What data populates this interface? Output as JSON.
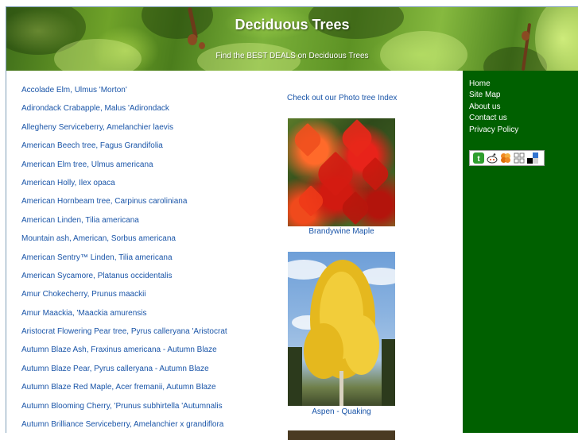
{
  "header": {
    "title": "Deciduous Trees",
    "subtitle": "Find the BEST DEALS on Deciduous Trees"
  },
  "trees": [
    "Accolade Elm, Ulmus 'Morton'",
    "Adirondack Crabapple, Malus 'Adirondack",
    "Allegheny Serviceberry, Amelanchier laevis",
    "American Beech tree, Fagus Grandifolia",
    "American Elm tree, Ulmus americana",
    "American Holly, Ilex opaca",
    "American Hornbeam tree, Carpinus caroliniana",
    "American Linden, Tilia americana",
    "Mountain ash, American, Sorbus americana",
    "American Sentry™ Linden, Tilia americana",
    "American Sycamore, Platanus occidentalis",
    "Amur Chokecherry, Prunus maackii",
    "Amur Maackia, 'Maackia amurensis",
    "Aristocrat Flowering Pear tree, Pyrus calleryana 'Aristocrat",
    "Autumn Blaze Ash, Fraxinus americana - Autumn Blaze",
    "Autumn Blaze Pear, Pyrus calleryana - Autumn Blaze",
    "Autumn Blaze Red Maple, Acer fremanii, Autumn Blaze",
    "Autumn Blooming Cherry, 'Prunus subhirtella 'Autumnalis",
    "Autumn Brilliance Serviceberry, Amelanchier x grandiflora"
  ],
  "photo_index": {
    "link_text": "Check out our Photo tree Index",
    "photos": [
      {
        "caption": "Brandywine Maple"
      },
      {
        "caption": "Aspen - Quaking"
      }
    ]
  },
  "sidebar": {
    "nav": [
      "Home",
      "Site Map",
      "About us",
      "Contact us",
      "Privacy Policy"
    ],
    "share_icons": [
      "technorati-icon",
      "reddit-icon",
      "stumbleupon-icon",
      "digg-icon",
      "delicious-icon"
    ]
  },
  "colors": {
    "link": "#1a55a8",
    "sidebar_bg": "#006000",
    "sidebar_text": "#ffffff"
  }
}
